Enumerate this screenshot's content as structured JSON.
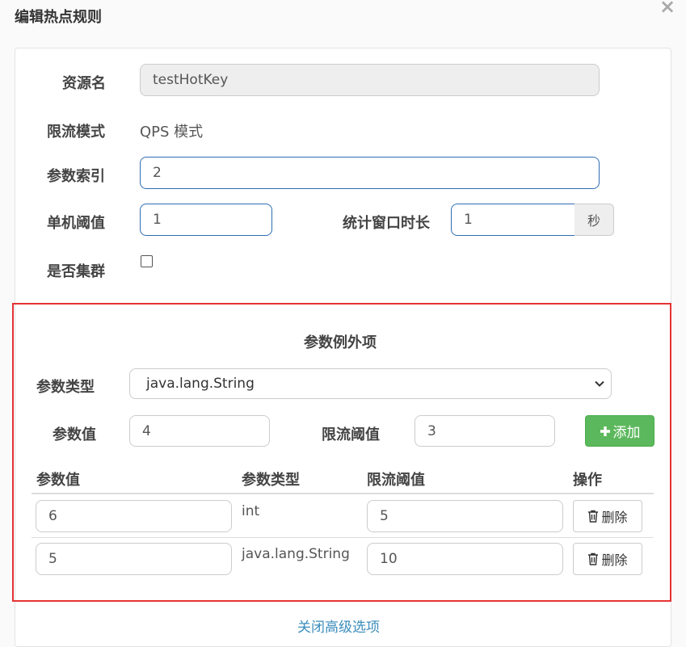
{
  "dialog": {
    "title": "编辑热点规则",
    "close": "×"
  },
  "form": {
    "resource_label": "资源名",
    "resource_value": "testHotKey",
    "mode_label": "限流模式",
    "mode_value": "QPS 模式",
    "param_index_label": "参数索引",
    "param_index_value": "2",
    "threshold_label": "单机阈值",
    "threshold_value": "1",
    "window_label": "统计窗口时长",
    "window_value": "1",
    "window_unit": "秒",
    "cluster_label": "是否集群",
    "cluster_checked": false
  },
  "exceptions": {
    "title": "参数例外项",
    "type_label": "参数类型",
    "type_selected": "java.lang.String",
    "value_label": "参数值",
    "value_input": "4",
    "limit_label": "限流阈值",
    "limit_input": "3",
    "add_label": "添加",
    "table_headers": [
      "参数值",
      "参数类型",
      "限流阈值",
      "操作"
    ],
    "rows": [
      {
        "value": "6",
        "type": "int",
        "limit": "5",
        "action": "删除"
      },
      {
        "value": "5",
        "type": "java.lang.String",
        "limit": "10",
        "action": "删除"
      }
    ]
  },
  "footer": {
    "link": "关闭高级选项"
  },
  "colors": {
    "accent": "#2f6db3",
    "add_button": "#5cb85c",
    "highlight_border": "#e53333",
    "link": "#3c8dbc"
  }
}
